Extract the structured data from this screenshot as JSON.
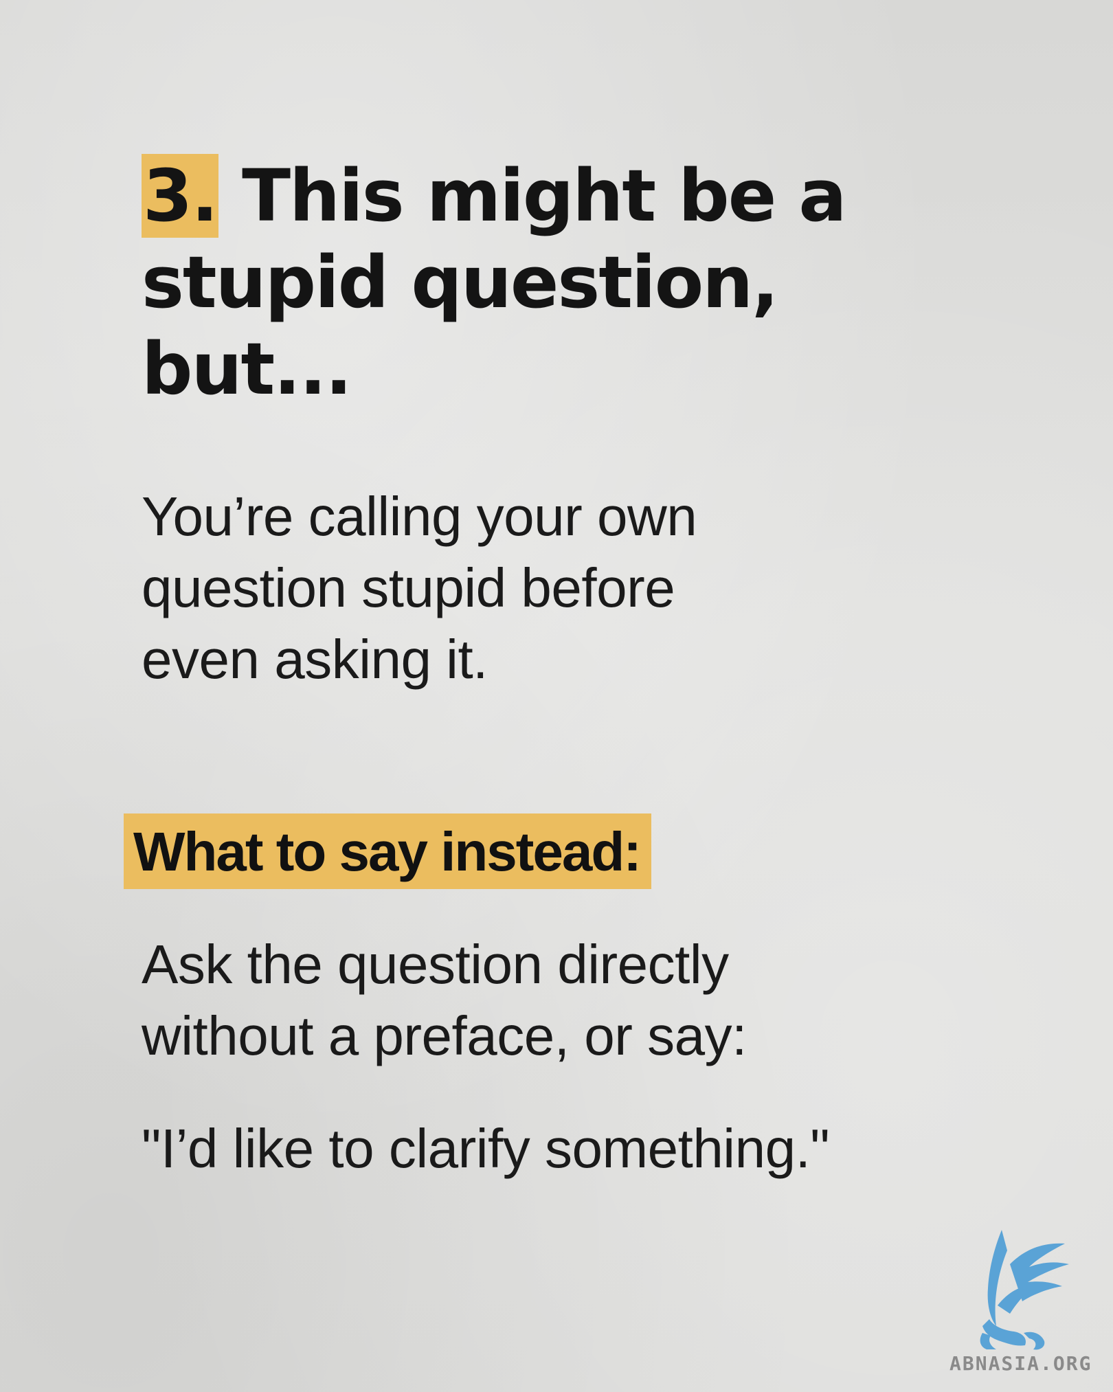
{
  "slide": {
    "number": "3.",
    "headline_rest": " This might be a stupid question, but...",
    "description": "You’re calling your own question stupid before even asking it.",
    "subheading": "What to say instead:",
    "advice": "Ask the question directly without a preface, or say:",
    "example": "\"I’d like to clarify something.\""
  },
  "brand": {
    "logo_text": "ABNASIA.ORG",
    "logo_icon": "griffin-icon",
    "logo_color": "#5aa3d6"
  },
  "colors": {
    "highlight": "#ebbd5f",
    "text": "#141414",
    "background": "#dcdcda"
  }
}
